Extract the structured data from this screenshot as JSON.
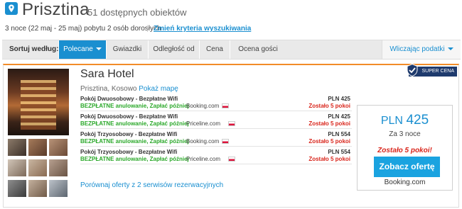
{
  "header": {
    "city": "Prisztina",
    "count": "51 dostępnych obiektów",
    "stay_details_bold": "3 noce (22 maj - 25 maj)",
    "stay_details_rest": " pobytu 2 osób dorosłych",
    "separator": "|",
    "change_link": "Zmień kryteria wyszukiwania",
    "pin_icon": "location-pin-icon",
    "accent": "#1a8fd0"
  },
  "sortbar": {
    "label": "Sortuj według:",
    "tabs": [
      {
        "label": "Polecane",
        "active": true
      },
      {
        "label": "Gwiazdki"
      },
      {
        "label": "Odległość od"
      },
      {
        "label": "Cena"
      },
      {
        "label": "Ocena gości"
      }
    ],
    "tax": "Wliczając podatki"
  },
  "hotel": {
    "name": "Sara Hotel",
    "location": "Prisztina, Kosowo",
    "map_link": "Pokaż mapę",
    "badge": "SUPER CENA",
    "offers": [
      {
        "room": "Pokój Dwuosobowy - Bezpłatne Wifi",
        "cancel": "BEZPŁATNE anulowanie, Zapłać później",
        "provider": "Booking.com",
        "price": "PLN 425",
        "left": "Zostało 5 pokoi"
      },
      {
        "room": "Pokój Dwuosobowy - Bezpłatne Wifi",
        "cancel": "BEZPŁATNE anulowanie, Zapłać później",
        "provider": "Priceline.com",
        "price": "PLN 425",
        "left": "Zostało 5 pokoi"
      },
      {
        "room": "Pokój Trzyosobowy - Bezpłatne Wifi",
        "cancel": "BEZPŁATNE anulowanie, Zapłać później",
        "provider": "Booking.com",
        "price": "PLN 554",
        "left": "Zostało 5 pokoi"
      },
      {
        "room": "Pokój Trzyosobowy - Bezpłatne Wifi",
        "cancel": "BEZPŁATNE anulowanie, Zapłać później",
        "provider": "Priceline.com",
        "price": "PLN 554",
        "left": "Zostało 5 pokoi"
      }
    ],
    "compare": "Porównaj oferty z 2 serwisów rezerwacyjnych",
    "box": {
      "currency": "PLN",
      "amount": "425",
      "nights": "Za 3 noce",
      "left": "Zostało 5 pokoi!",
      "cta": "Zobacz ofertę",
      "source": "Booking.com"
    }
  }
}
